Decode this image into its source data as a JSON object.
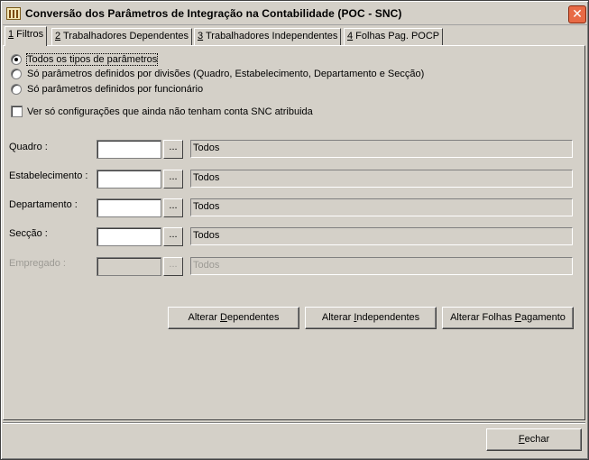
{
  "window": {
    "title": "Conversão dos Parâmetros de Integração na Contabilidade (POC - SNC)",
    "close_glyph": "✕"
  },
  "tabs": [
    {
      "hotkey": "1",
      "label": " Filtros"
    },
    {
      "hotkey": "2",
      "label": " Trabalhadores Dependentes"
    },
    {
      "hotkey": "3",
      "label": " Trabalhadores Independentes"
    },
    {
      "hotkey": "4",
      "label": " Folhas Pag. POCP"
    }
  ],
  "filters": {
    "radios": [
      {
        "label": "Todos os tipos de parâmetros",
        "checked": true
      },
      {
        "label": "Só parâmetros definidos por divisões (Quadro, Estabelecimento, Departamento e Secção)",
        "checked": false
      },
      {
        "label": "Só parâmetros definidos por funcionário",
        "checked": false
      }
    ],
    "checkbox": {
      "label": "Ver só configurações que ainda não tenham conta SNC atribuida",
      "checked": false
    }
  },
  "fields": [
    {
      "label": "Quadro :",
      "value": "",
      "browse": "...",
      "display": "Todos",
      "enabled": true
    },
    {
      "label": "Estabelecimento :",
      "value": "",
      "browse": "...",
      "display": "Todos",
      "enabled": true
    },
    {
      "label": "Departamento :",
      "value": "",
      "browse": "...",
      "display": "Todos",
      "enabled": true
    },
    {
      "label": "Secção :",
      "value": "",
      "browse": "...",
      "display": "Todos",
      "enabled": true
    },
    {
      "label": "Empregado :",
      "value": "",
      "browse": "...",
      "display": "Todos",
      "enabled": false
    }
  ],
  "actions": {
    "dependentes": {
      "before": "Alterar ",
      "hotkey": "D",
      "after": "ependentes"
    },
    "independentes": {
      "before": "Alterar ",
      "hotkey": "I",
      "after": "ndependentes"
    },
    "folhas": {
      "before": "Alterar Folhas ",
      "hotkey": "P",
      "after": "agamento"
    }
  },
  "footer": {
    "close": {
      "before": "",
      "hotkey": "F",
      "after": "echar"
    }
  }
}
